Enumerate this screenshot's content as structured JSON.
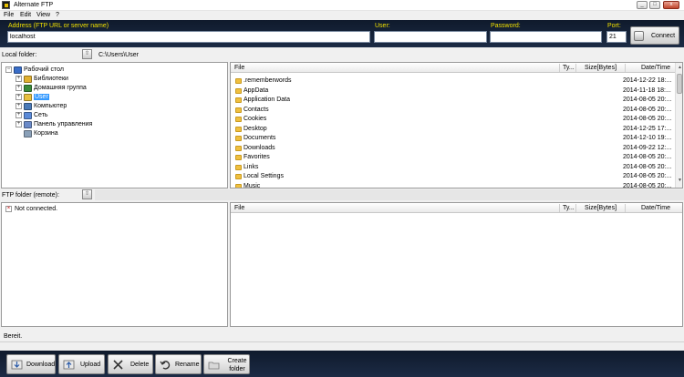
{
  "window": {
    "title": "Alternate FTP",
    "minimize": "_",
    "maximize": "□",
    "close": "x"
  },
  "menu": [
    "File",
    "Edit",
    "View",
    "?"
  ],
  "connection": {
    "address_label": "Address (FTP URL or server name)",
    "address_value": "localhost",
    "user_label": "User:",
    "user_value": "",
    "password_label": "Password:",
    "password_value": "",
    "port_label": "Port:",
    "port_value": "21",
    "connect_label": "Connect"
  },
  "local": {
    "label": "Local folder:",
    "path": "C:\\Users\\User",
    "tree": [
      {
        "label": "Рабочий стол",
        "expander": "−",
        "icon": "desktop-icon",
        "color": "#3a6ec8"
      },
      {
        "label": "Библиотеки",
        "expander": "+",
        "icon": "libraries-icon",
        "color": "#e0b030"
      },
      {
        "label": "Домашняя группа",
        "expander": "+",
        "icon": "homegroup-icon",
        "color": "#3a8a3a"
      },
      {
        "label": "User",
        "expander": "+",
        "icon": "user-folder-icon",
        "color": "#e8c040",
        "selected": true
      },
      {
        "label": "Компьютер",
        "expander": "+",
        "icon": "computer-icon",
        "color": "#4a7ab8"
      },
      {
        "label": "Сеть",
        "expander": "+",
        "icon": "network-icon",
        "color": "#5a8ad8"
      },
      {
        "label": "Панель управления",
        "expander": "+",
        "icon": "control-panel-icon",
        "color": "#6a8ac8"
      },
      {
        "label": "Корзина",
        "expander": "",
        "icon": "recycle-bin-icon",
        "color": "#8aa0b8"
      }
    ],
    "columns": [
      "File",
      "Ty...",
      "Size[Bytes]",
      "Date/Time"
    ],
    "files": [
      {
        "name": ".rememberwords",
        "date": "2014-12-22 18:..."
      },
      {
        "name": "AppData",
        "date": "2014-11-18 18:..."
      },
      {
        "name": "Application Data",
        "date": "2014-08-05 20:..."
      },
      {
        "name": "Contacts",
        "date": "2014-08-05 20:..."
      },
      {
        "name": "Cookies",
        "date": "2014-08-05 20:..."
      },
      {
        "name": "Desktop",
        "date": "2014-12-25 17:..."
      },
      {
        "name": "Documents",
        "date": "2014-12-10 19:..."
      },
      {
        "name": "Downloads",
        "date": "2014-09-22 12:..."
      },
      {
        "name": "Favorites",
        "date": "2014-08-05 20:..."
      },
      {
        "name": "Links",
        "date": "2014-08-05 20:..."
      },
      {
        "name": "Local Settings",
        "date": "2014-08-05 20:..."
      },
      {
        "name": "Music",
        "date": "2014-08-05 20:..."
      }
    ]
  },
  "remote": {
    "label": "FTP folder (remote):",
    "not_connected": "Not connected.",
    "columns": [
      "File",
      "Ty...",
      "Size[Bytes]",
      "Date/Time"
    ]
  },
  "status_text": "Bereit.",
  "toolbar": {
    "download": "Download",
    "upload": "Upload",
    "delete": "Delete",
    "rename": "Rename",
    "create_folder_1": "Create",
    "create_folder_2": "folder"
  }
}
